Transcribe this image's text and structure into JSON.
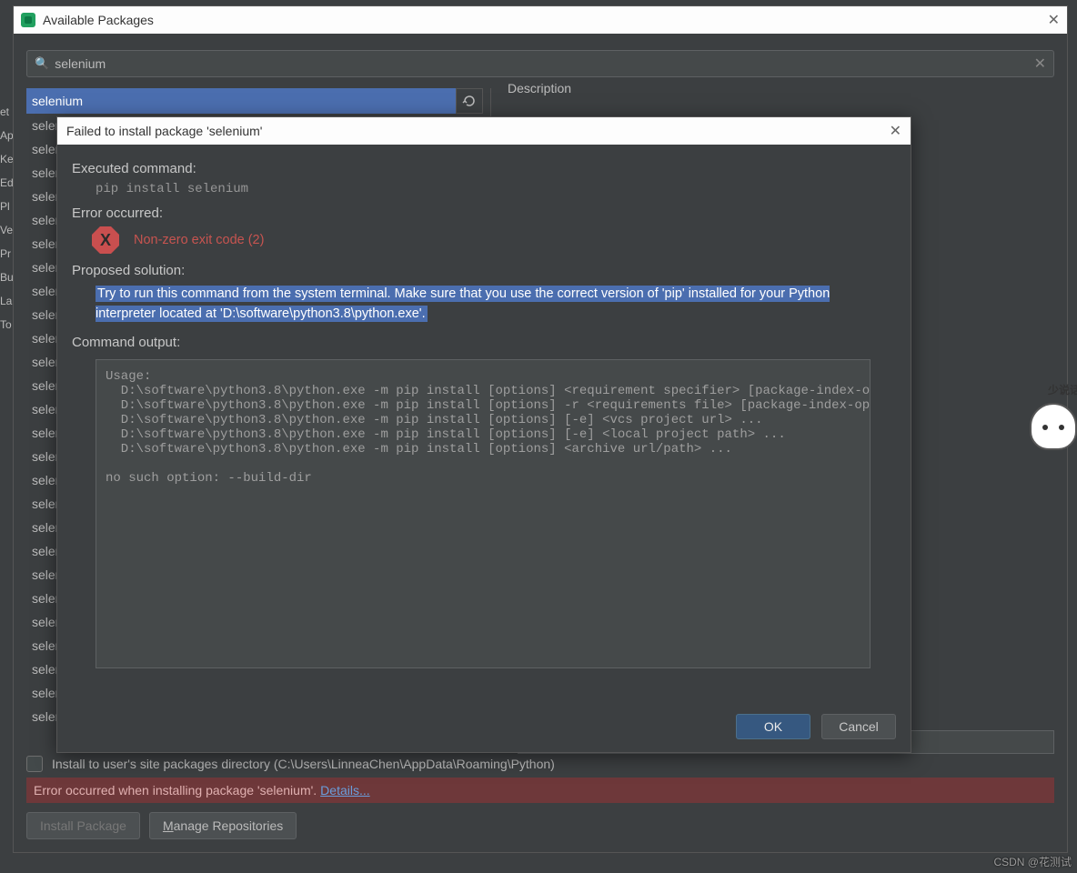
{
  "window": {
    "title": "Available Packages"
  },
  "sidebar_hints": [
    "et",
    "Ap",
    "Ke",
    "Ed",
    "Pl",
    "Ve",
    "Pr",
    "",
    "",
    "Bu",
    "La",
    "To"
  ],
  "search": {
    "value": "selenium"
  },
  "list": {
    "selected": "selenium",
    "items": [
      "selen",
      "selen",
      "selen",
      "selen",
      "selen",
      "selen",
      "selen",
      "selen",
      "selen",
      "selen",
      "selen",
      "selen",
      "selen",
      "selen",
      "selen",
      "selen",
      "selen",
      "selen",
      "selen",
      "selen",
      "selen",
      "selen",
      "selen",
      "selen",
      "selen",
      "selen"
    ]
  },
  "right": {
    "description_label": "Description"
  },
  "footer": {
    "install_to_user_label": "Install to user's site packages directory (C:\\Users\\LinneaChen\\AppData\\Roaming\\Python)",
    "error_text": "Error occurred when installing package 'selenium'. ",
    "details_link": "Details...",
    "install_btn": "Install Package",
    "manage_btn_prefix": "M",
    "manage_btn_rest": "anage Repositories"
  },
  "dialog": {
    "title": "Failed to install package 'selenium'",
    "executed_label": "Executed command:",
    "executed_cmd": "pip install selenium",
    "error_label": "Error occurred:",
    "error_msg": "Non-zero exit code (2)",
    "solution_label": "Proposed solution:",
    "solution_text": "Try to run this command from the system terminal. Make sure that you use the correct version of 'pip' installed for your Python interpreter located at 'D:\\software\\python3.8\\python.exe'.",
    "output_label": "Command output:",
    "output_text": "Usage:\n  D:\\software\\python3.8\\python.exe -m pip install [options] <requirement specifier> [package-index-options] ...\n  D:\\software\\python3.8\\python.exe -m pip install [options] -r <requirements file> [package-index-options] ...\n  D:\\software\\python3.8\\python.exe -m pip install [options] [-e] <vcs project url> ...\n  D:\\software\\python3.8\\python.exe -m pip install [options] [-e] <local project path> ...\n  D:\\software\\python3.8\\python.exe -m pip install [options] <archive url/path> ...\n\nno such option: --build-dir",
    "ok": "OK",
    "cancel": "Cancel"
  },
  "mascot_text": "少说话",
  "watermark": "CSDN @花测试"
}
